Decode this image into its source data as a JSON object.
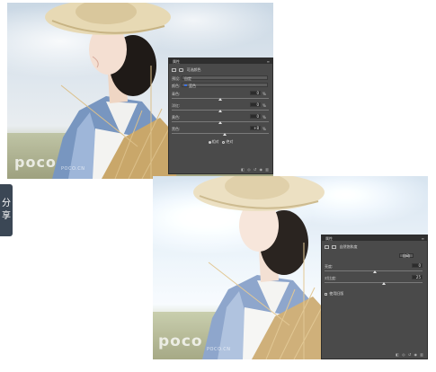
{
  "watermark": {
    "brand": "poco",
    "subtitle": "POCO.CN"
  },
  "share": {
    "char1": "分",
    "char2": "享"
  },
  "panel1": {
    "tab_label": "属性",
    "title": "可选颜色",
    "preset_label": "预设:",
    "preset_value": "自定",
    "colors_label": "颜色:",
    "colors_value": "蓝色",
    "sliders": [
      {
        "label": "青色:",
        "value": "0",
        "unit": "%"
      },
      {
        "label": "洋红:",
        "value": "0",
        "unit": "%"
      },
      {
        "label": "黄色:",
        "value": "0",
        "unit": "%"
      },
      {
        "label": "黑色:",
        "value": "+8",
        "unit": "%"
      }
    ],
    "method_relative": "相对",
    "method_absolute": "绝对"
  },
  "panel2": {
    "tab_label": "属性",
    "title": "自然饱和度",
    "auto_button": "自动",
    "vibrance_label": "亮度:",
    "vibrance_value": "0",
    "saturation_label": "对比度:",
    "saturation_value": "25",
    "legacy_label": "使用旧版"
  }
}
